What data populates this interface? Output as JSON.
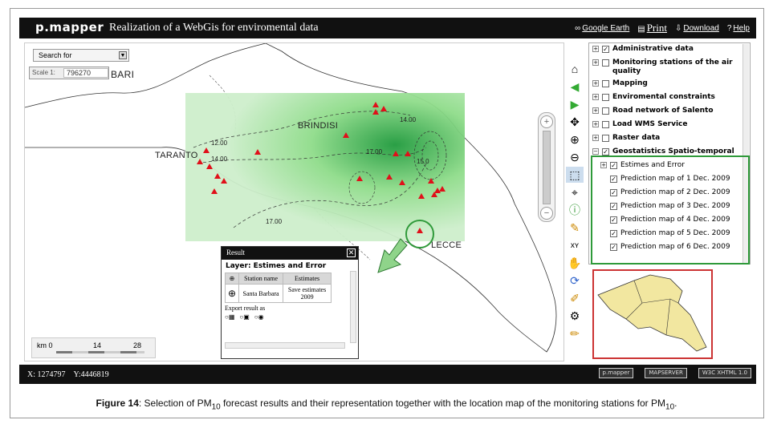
{
  "header": {
    "brand": "p.mapper",
    "title": "Realization of a WebGis for enviromental data",
    "links": {
      "google_earth": "Google Earth",
      "print": "Print",
      "download": "Download",
      "help": "Help"
    }
  },
  "map": {
    "search_placeholder": "Search for",
    "scale_label": "Scale 1:",
    "scale_value": "796270",
    "cities": {
      "bari": "BARI",
      "brindisi": "BRINDISI",
      "taranto": "TARANTO",
      "lecce": "LECCE"
    },
    "contours": [
      "12.00",
      "14.00",
      "14.00",
      "17.00",
      "17.00",
      "15.0"
    ],
    "km_scale": [
      "km 0",
      "14",
      "28"
    ],
    "zoom_in": "+",
    "zoom_out": "−"
  },
  "result": {
    "title": "Result",
    "layer_label": "Layer: Estimes and Error",
    "columns": [
      "Station name",
      "Estimates"
    ],
    "station": "Santa Barbara",
    "estimate": "Save estimates 2009",
    "export_label": "Export result as"
  },
  "layers": [
    {
      "label": "Administrative data",
      "checked": true,
      "expand": "+"
    },
    {
      "label": "Monitoring stations of the air quality",
      "checked": false,
      "expand": "+"
    },
    {
      "label": "Mapping",
      "checked": false,
      "expand": "+"
    },
    {
      "label": "Enviromental constraints",
      "checked": false,
      "expand": "+"
    },
    {
      "label": "Road network of Salento",
      "checked": false,
      "expand": "+"
    },
    {
      "label": "Load WMS Service",
      "checked": false,
      "expand": "+"
    },
    {
      "label": "Raster data",
      "checked": false,
      "expand": "+"
    },
    {
      "label": "Geostatistics Spatio-temporal",
      "checked": true,
      "expand": "−"
    }
  ],
  "geostat_children": {
    "estimes": "Estimes and Error",
    "predictions": [
      "Prediction map of 1 Dec. 2009",
      "Prediction map of 2 Dec. 2009",
      "Prediction map of 3 Dec. 2009",
      "Prediction map of 4 Dec. 2009",
      "Prediction map of 5 Dec. 2009",
      "Prediction map of 6 Dec. 2009"
    ]
  },
  "status": {
    "x": "X: 1274797",
    "y": "Y:4446819",
    "badges": [
      "p.mapper",
      "MAPSERVER",
      "W3C XHTML 1.0"
    ]
  },
  "caption": {
    "label": "Figure 14",
    "text_a": ": Selection of PM",
    "sub1": "10",
    "text_b": " forecast results and their representation together with the location map of the monitoring stations for PM",
    "sub2": "10",
    "text_c": "."
  },
  "colors": {
    "accent_green": "#2f9a3a",
    "marker_red": "#e0101a",
    "ref_border": "#cc3333"
  }
}
